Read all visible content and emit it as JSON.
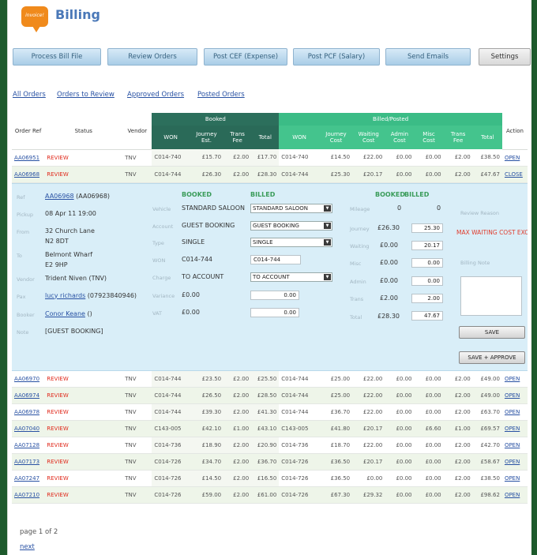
{
  "header": {
    "logo_text": "invoice!",
    "title": "Billing"
  },
  "toolbar": {
    "process": "Process Bill File",
    "review": "Review Orders",
    "post_cef": "Post CEF (Expense)",
    "post_pcf": "Post PCF (Salary)",
    "emails": "Send Emails",
    "settings": "Settings"
  },
  "filters": {
    "all": "All Orders",
    "review": "Orders to Review",
    "approved": "Approved Orders",
    "posted": "Posted Orders"
  },
  "table": {
    "headers": {
      "order_ref": "Order Ref",
      "status": "Status",
      "vendor": "Vendor",
      "booked_group": "Booked",
      "billed_group": "Billed/Posted",
      "action": "Action",
      "booked_cols": [
        "WON",
        "Journey Est.",
        "Trans Fee",
        "Total"
      ],
      "billed_cols": [
        "WON",
        "Journey Cost",
        "Waiting Cost",
        "Admin Cost",
        "Misc Cost",
        "Trans Fee",
        "Total"
      ]
    },
    "rows_top": [
      {
        "ref": "AA06951",
        "status": "REVIEW",
        "vendor": "TNV",
        "b_won": "C014-740",
        "b_je": "£15.70",
        "b_tf": "£2.00",
        "b_tot": "£17.70",
        "p_won": "C014-740",
        "p_jc": "£14.50",
        "p_wc": "£22.00",
        "p_ac": "£0.00",
        "p_mc": "£0.00",
        "p_tf": "£2.00",
        "p_tot": "£38.50",
        "action": "OPEN"
      },
      {
        "ref": "AA06968",
        "status": "REVIEW",
        "vendor": "TNV",
        "b_won": "C014-744",
        "b_je": "£26.30",
        "b_tf": "£2.00",
        "b_tot": "£28.30",
        "p_won": "C014-744",
        "p_jc": "£25.30",
        "p_wc": "£20.17",
        "p_ac": "£0.00",
        "p_mc": "£0.00",
        "p_tf": "£2.00",
        "p_tot": "£47.67",
        "action": "CLOSE"
      }
    ],
    "rows_bottom": [
      {
        "ref": "AA06970",
        "status": "REVIEW",
        "vendor": "TNV",
        "b_won": "C014-744",
        "b_je": "£23.50",
        "b_tf": "£2.00",
        "b_tot": "£25.50",
        "p_won": "C014-744",
        "p_jc": "£25.00",
        "p_wc": "£22.00",
        "p_ac": "£0.00",
        "p_mc": "£0.00",
        "p_tf": "£2.00",
        "p_tot": "£49.00",
        "action": "OPEN"
      },
      {
        "ref": "AA06974",
        "status": "REVIEW",
        "vendor": "TNV",
        "b_won": "C014-744",
        "b_je": "£26.50",
        "b_tf": "£2.00",
        "b_tot": "£28.50",
        "p_won": "C014-744",
        "p_jc": "£25.00",
        "p_wc": "£22.00",
        "p_ac": "£0.00",
        "p_mc": "£0.00",
        "p_tf": "£2.00",
        "p_tot": "£49.00",
        "action": "OPEN"
      },
      {
        "ref": "AA06978",
        "status": "REVIEW",
        "vendor": "TNV",
        "b_won": "C014-744",
        "b_je": "£39.30",
        "b_tf": "£2.00",
        "b_tot": "£41.30",
        "p_won": "C014-744",
        "p_jc": "£36.70",
        "p_wc": "£22.00",
        "p_ac": "£0.00",
        "p_mc": "£0.00",
        "p_tf": "£2.00",
        "p_tot": "£63.70",
        "action": "OPEN"
      },
      {
        "ref": "AA07040",
        "status": "REVIEW",
        "vendor": "TNV",
        "b_won": "C143-005",
        "b_je": "£42.10",
        "b_tf": "£1.00",
        "b_tot": "£43.10",
        "p_won": "C143-005",
        "p_jc": "£41.80",
        "p_wc": "£20.17",
        "p_ac": "£0.00",
        "p_mc": "£6.60",
        "p_tf": "£1.00",
        "p_tot": "£69.57",
        "action": "OPEN"
      },
      {
        "ref": "AA07128",
        "status": "REVIEW",
        "vendor": "TNV",
        "b_won": "C014-736",
        "b_je": "£18.90",
        "b_tf": "£2.00",
        "b_tot": "£20.90",
        "p_won": "C014-736",
        "p_jc": "£18.70",
        "p_wc": "£22.00",
        "p_ac": "£0.00",
        "p_mc": "£0.00",
        "p_tf": "£2.00",
        "p_tot": "£42.70",
        "action": "OPEN"
      },
      {
        "ref": "AA07173",
        "status": "REVIEW",
        "vendor": "TNV",
        "b_won": "C014-726",
        "b_je": "£34.70",
        "b_tf": "£2.00",
        "b_tot": "£36.70",
        "p_won": "C014-726",
        "p_jc": "£36.50",
        "p_wc": "£20.17",
        "p_ac": "£0.00",
        "p_mc": "£0.00",
        "p_tf": "£2.00",
        "p_tot": "£58.67",
        "action": "OPEN"
      },
      {
        "ref": "AA07247",
        "status": "REVIEW",
        "vendor": "TNV",
        "b_won": "C014-726",
        "b_je": "£14.50",
        "b_tf": "£2.00",
        "b_tot": "£16.50",
        "p_won": "C014-726",
        "p_jc": "£36.50",
        "p_wc": "£0.00",
        "p_ac": "£0.00",
        "p_mc": "£0.00",
        "p_tf": "£2.00",
        "p_tot": "£38.50",
        "action": "OPEN"
      },
      {
        "ref": "AA07210",
        "status": "REVIEW",
        "vendor": "TNV",
        "b_won": "C014-726",
        "b_je": "£59.00",
        "b_tf": "£2.00",
        "b_tot": "£61.00",
        "p_won": "C014-726",
        "p_jc": "£67.30",
        "p_wc": "£29.32",
        "p_ac": "£0.00",
        "p_mc": "£0.00",
        "p_tf": "£2.00",
        "p_tot": "£98.62",
        "action": "OPEN"
      }
    ]
  },
  "detail": {
    "labels": {
      "ref": "Ref",
      "pickup": "Pickup",
      "from": "From",
      "to": "To",
      "vendor": "Vendor",
      "pax": "Pax",
      "booker": "Booker",
      "note": "Note",
      "vehicle": "Vehicle",
      "account": "Account",
      "type": "Type",
      "won": "WON",
      "charge": "Charge",
      "variance": "Variance",
      "vat": "VAT",
      "mileage": "Mileage",
      "journey": "Journey",
      "waiting": "Waiting",
      "misc": "Misc",
      "admin": "Admin",
      "trans": "Trans",
      "total": "Total",
      "reason": "Review Reason",
      "billing_note": "Billing Note"
    },
    "ref_link": "AA06968",
    "ref_suffix": "(AA06968)",
    "pickup": "08 Apr 11 19:00",
    "from1": "32 Church Lane",
    "from2": "N2 8DT",
    "to1": "Belmont Wharf",
    "to2": "E2 9HP",
    "vendor": "Trident Niven (TNV)",
    "pax_link": "lucy richards",
    "pax_phone": "(07923840946)",
    "booker_link": "Conor Keane",
    "booker_suffix": "()",
    "note": "[GUEST BOOKING]",
    "booked_head": "BOOKED",
    "billed_head": "BILLED",
    "booked_head2": "BOOKED",
    "billed_head2": "BILLED",
    "vehicle_booked": "STANDARD SALOON",
    "vehicle_billed": "STANDARD SALOON",
    "account_booked": "GUEST BOOKING",
    "account_billed": "GUEST BOOKING",
    "type_booked": "SINGLE",
    "type_billed": "SINGLE",
    "won_booked": "C014-744",
    "won_billed": "C014-744",
    "charge_booked": "TO ACCOUNT",
    "charge_billed": "TO ACCOUNT",
    "variance_booked": "£0.00",
    "variance_billed": "0.00",
    "vat_booked": "£0.00",
    "vat_billed": "0.00",
    "mileage_booked": "0",
    "mileage_billed": "0",
    "journey_booked": "£26.30",
    "journey_billed": "25.30",
    "waiting_booked": "£0.00",
    "waiting_billed": "20.17",
    "misc_booked": "£0.00",
    "misc_billed": "0.00",
    "admin_booked": "£0.00",
    "admin_billed": "0.00",
    "trans_booked": "£2.00",
    "trans_billed": "2.00",
    "total_booked": "£28.30",
    "total_billed": "47.67",
    "warning": "MAX WAITING COST EXCEEDED.",
    "save": "SAVE",
    "save_approve": "SAVE + APPROVE"
  },
  "footer": {
    "pager": "page 1 of 2",
    "next": "next"
  }
}
